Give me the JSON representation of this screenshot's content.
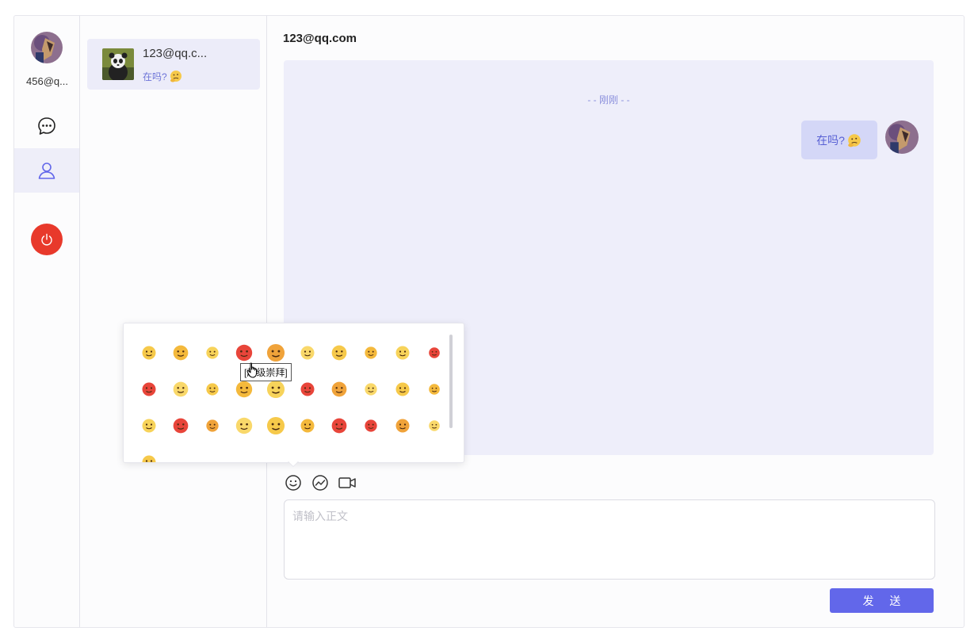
{
  "current_user": {
    "name": "456@q..."
  },
  "nav": {
    "chat_icon": "chat-bubble-icon",
    "contacts_icon": "user-icon",
    "logout_icon": "power-icon"
  },
  "contacts": [
    {
      "name": "123@qq.c...",
      "last_message": "在吗?"
    }
  ],
  "chat": {
    "title": "123@qq.com",
    "time_divider": "- - 刚刚 - -",
    "messages": [
      {
        "from": "me",
        "text": "在吗?"
      }
    ]
  },
  "emoji_panel": {
    "tooltip": "[超级崇拜]"
  },
  "composer": {
    "placeholder": "请输入正文",
    "send_label": "发 送"
  },
  "colors": {
    "accent": "#6267ea",
    "power": "#e8392b",
    "chat_bg": "#eeeefa",
    "bubble": "#d4d7f7"
  }
}
